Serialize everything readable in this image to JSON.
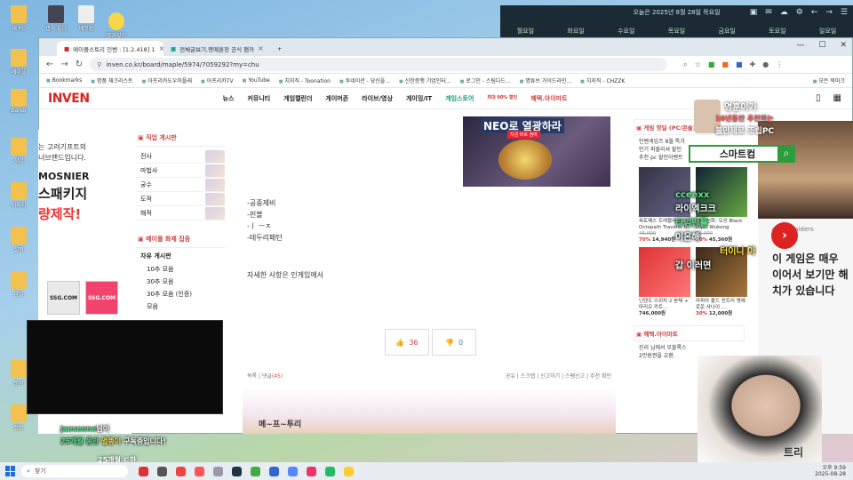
{
  "desktop": {
    "icons": [
      "내 PC",
      "캡처 폴더",
      "메모장",
      "즐겨찾기",
      "메이플",
      "Bandi",
      "게임",
      "이미지",
      "설정",
      "파일",
      "문서",
      "정보"
    ]
  },
  "system": {
    "date_text": "오늘은 2025년 8월 28일 목요일",
    "weekdays": [
      "월요일",
      "화요일",
      "수요일",
      "목요일",
      "금요일",
      "토요일",
      "일요일"
    ],
    "clock_time": "오후 9:59",
    "clock_date": "2025-08-28"
  },
  "browser": {
    "tabs": [
      {
        "label": "메이플스토리 인벤 : [1.2.418] 1",
        "active": true
      },
      {
        "label": "전체글보기,명예훈장 공식 팬카",
        "active": false
      }
    ],
    "new_tab": "+",
    "url": "inven.co.kr/board/maple/5974/7059292?my=chu",
    "bookmarks": [
      "Bookmarks",
      "명품 채크리스트",
      "아프리카도우미플래",
      "아프리카TV",
      "YouTube",
      "치지직 - Toonation",
      "투네이션 - 당신을...",
      "신한증행 기업인터...",
      "로그인 - 스팀다드...",
      "명튜브 가이드라인...",
      "치지직 - CHZZK"
    ],
    "bookmarks_right": "모든 북마크"
  },
  "inven": {
    "logo": "INVEN",
    "nav": [
      "뉴스",
      "커뮤니티",
      "게임캘린더",
      "게이머존",
      "라이브/영상",
      "게이밍/IT",
      "게임스토어",
      "혜택.아이마트"
    ],
    "store_badge": "최대 90% 할인"
  },
  "left_ad": {
    "line1": "는 고려기프트의",
    "line2": "너브랜드입니다.",
    "brand": "MOSNIER",
    "headline1": "스패키지",
    "headline2": "량제작!",
    "ssg1": "SSG.COM",
    "ssg2": "SSG.COM"
  },
  "sidebar": {
    "job_title": "직업 게시판",
    "jobs": [
      "전사",
      "마법사",
      "궁수",
      "도적",
      "해적"
    ],
    "hot_title": "메이플 화제 집중",
    "free_title": "자유 게시판",
    "free_items": [
      "10추 모음",
      "30추 모음",
      "30추 모음 (인증)",
      "모음"
    ]
  },
  "article": {
    "banner_title": "NEO로 열광하라",
    "banner_sub": "지금 바로 참여",
    "lines": [
      "-공중제비",
      "-핀볼",
      "-ㅣ ㅡㅈ",
      "-테두리패턴"
    ],
    "detail": "자세한 사항은 인게임에서",
    "upvote": "36",
    "downvote": "0",
    "foot_left_list": "목록",
    "foot_left_comment": "댓글",
    "foot_comment_count": "(45)",
    "foot_right": [
      "공유",
      "스크랩",
      "신고하기",
      "스팸신고",
      "추천 확인"
    ],
    "bottom_text": "메~프~투리"
  },
  "right_col": {
    "hot_title": "게임 핫딜 (PC/콘솔)",
    "hot_list": [
      "인벤게임즈 8월 특가",
      "인기 퍼블리셔 할인",
      "추천 pc 할인이벤트"
    ],
    "cards": [
      {
        "title": "옥토패스 트래블러 II Octopath Traveler II",
        "orig": "45,000",
        "pct": "70%",
        "price": "14,940원"
      },
      {
        "title": "검은 신화: 오공 Black Myth Wukong",
        "orig": "44,000",
        "pct": "30%",
        "price": "45,360원"
      },
      {
        "title": "닌텐도 스위치 2 본체 + 마리오 카트...",
        "orig": "",
        "pct": "",
        "price": "746,000원"
      },
      {
        "title": "마피아 올드 컨트리 명예로운 사나이 ...",
        "orig": "",
        "pct": "30%",
        "price": "12,000원"
      }
    ],
    "mart_title": "혜택.아이마트",
    "mart_line1": "진리 님에서 모블록스",
    "mart_line2": "2만원권을 교환."
  },
  "right_ad": {
    "source": "game-raiders",
    "line1": "이 게임은 매우",
    "line2": "이어서 보기만 해",
    "line3": "치가 있습니다"
  },
  "overlay": {
    "promo_top": "명훈이가",
    "promo_mid": "10년동안 추천하는",
    "promo_bot": "불만제로 조립PC",
    "promo_box": "스마트컴",
    "chat_right": [
      "cceexx",
      "라이엑크크",
      "타임반틀",
      "이온해",
      "터이니 아",
      "갑 이러면"
    ],
    "chat_left_user": "jaeseone",
    "chat_left_line1_suffix": "님이",
    "chat_left_line2": "25개월 동안",
    "chat_left_line2_name": "멀뚱이",
    "chat_left_line2_end": " 구독중입니다!",
    "sub_line": "25개월 ㄷ하",
    "streamer_tag": "트리"
  },
  "taskbar": {
    "search_placeholder": "찾기"
  }
}
